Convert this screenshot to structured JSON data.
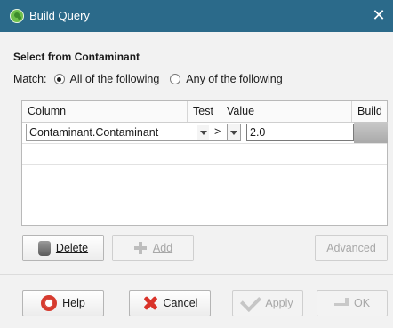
{
  "window": {
    "title": "Build Query",
    "close_glyph": "✕"
  },
  "section_title": "Select from Contaminant",
  "match": {
    "label": "Match:",
    "options": [
      {
        "label": "All of the following",
        "selected": true
      },
      {
        "label": "Any of the following",
        "selected": false
      }
    ]
  },
  "grid": {
    "columns": [
      "Column",
      "Test",
      "Value",
      "Build"
    ],
    "rows": [
      {
        "column": "Contaminant.Contaminant",
        "test": ">",
        "value": "2.0"
      }
    ]
  },
  "buttons": {
    "delete": "Delete",
    "add": "Add",
    "advanced": "Advanced",
    "help": "Help",
    "cancel": "Cancel",
    "apply": "Apply",
    "ok": "OK"
  },
  "colors": {
    "titlebar": "#2b6a8a",
    "accent_green": "#6dbf4b"
  }
}
